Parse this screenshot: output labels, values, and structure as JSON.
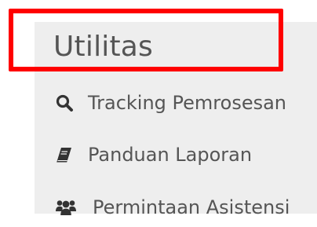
{
  "panel": {
    "title": "Utilitas",
    "items": [
      {
        "label": "Tracking Pemrosesan",
        "icon": "search-icon"
      },
      {
        "label": "Panduan Laporan",
        "icon": "book-icon"
      },
      {
        "label": "Permintaan Asistensi",
        "icon": "users-icon"
      }
    ]
  },
  "colors": {
    "panel_bg": "#eeeeee",
    "text": "#555555",
    "icon": "#333333",
    "highlight": "#ff0000"
  }
}
